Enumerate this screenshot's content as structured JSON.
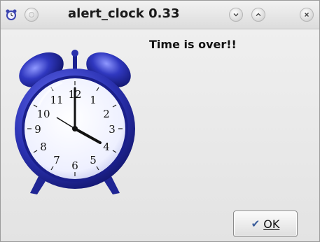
{
  "window": {
    "title": "alert_clock 0.33",
    "controls": {
      "menu_icon": "alarm-clock-icon",
      "sticky_icon": "circle-icon",
      "minimize_icon": "chevron-down-icon",
      "maximize_icon": "chevron-up-icon",
      "close_icon": "close-icon"
    }
  },
  "dialog": {
    "message": "Time is over!!",
    "ok_button": {
      "label": "OK",
      "icon": "checkmark-icon"
    },
    "image": {
      "icon": "alarm-clock-icon",
      "dial_numbers": [
        "12",
        "1",
        "2",
        "3",
        "4",
        "5",
        "6",
        "7",
        "8",
        "9",
        "10",
        "11"
      ]
    }
  },
  "colors": {
    "clock_blue": "#2f36b8",
    "check_blue": "#3d5f9c",
    "window_bg": "#e9e9e9"
  }
}
